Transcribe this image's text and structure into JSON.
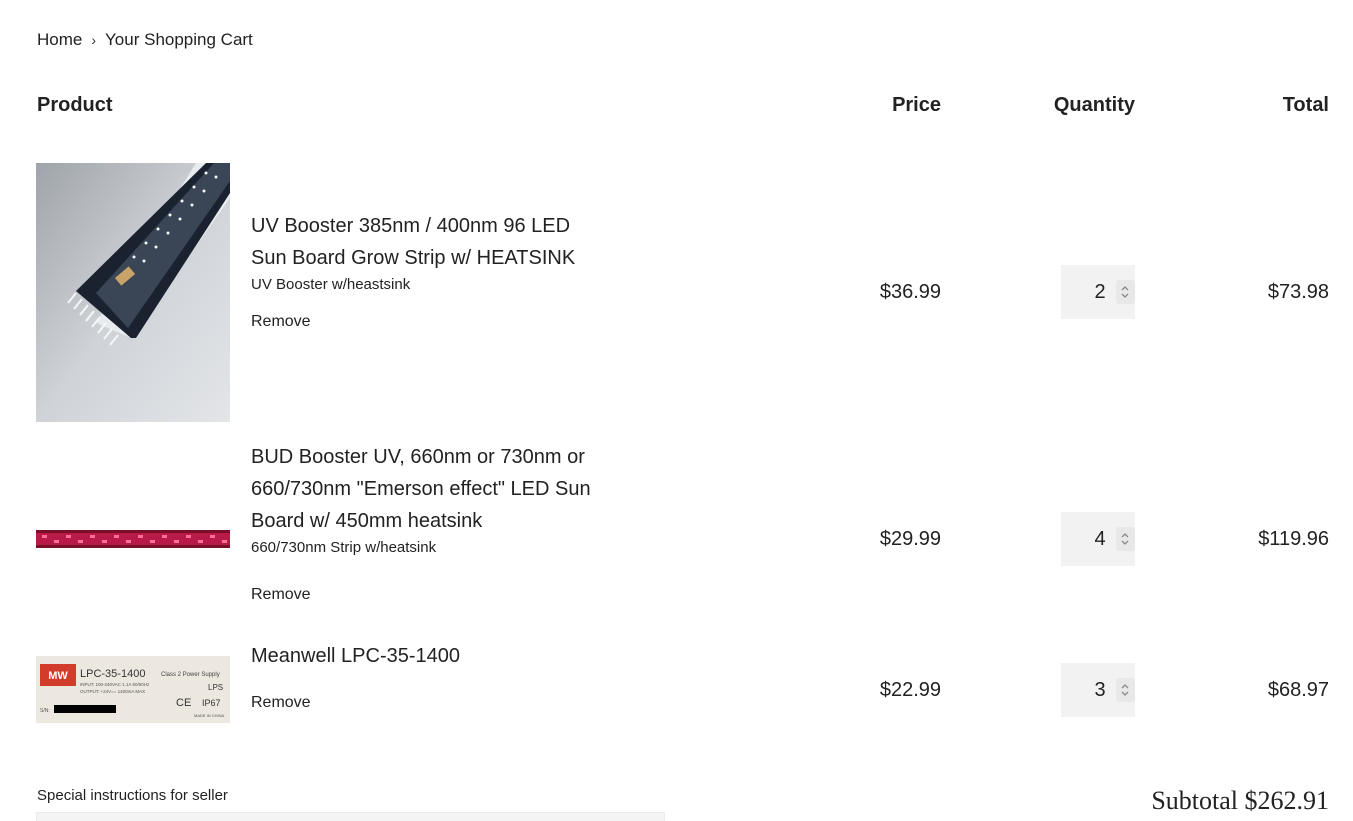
{
  "breadcrumb": {
    "home": "Home",
    "separator": "›",
    "current": "Your Shopping Cart"
  },
  "table_headers": {
    "product": "Product",
    "price": "Price",
    "quantity": "Quantity",
    "total": "Total"
  },
  "items": [
    {
      "title": "UV Booster 385nm / 400nm 96 LED Sun Board Grow Strip w/ HEATSINK",
      "variant": "UV Booster w/heastsink",
      "remove_label": "Remove",
      "price": "$36.99",
      "quantity": "2",
      "total": "$73.98",
      "image_icon": "led-strip-white-photo"
    },
    {
      "title": "BUD Booster UV, 660nm or 730nm or 660/730nm \"Emerson effect\" LED Sun Board w/ 450mm heatsink",
      "variant": "660/730nm Strip w/heatsink",
      "remove_label": "Remove",
      "price": "$29.99",
      "quantity": "4",
      "total": "$119.96",
      "image_icon": "led-strip-red-photo"
    },
    {
      "title": "Meanwell LPC-35-1400",
      "remove_label": "Remove",
      "price": "$22.99",
      "quantity": "3",
      "total": "$68.97",
      "image_icon": "power-supply-label-photo",
      "label_text": {
        "brand": "MW",
        "model": "LPC-35-1400",
        "class": "Class 2 Power Supply",
        "input": "INPUT: 100-240VAC 1.1A 50/60Hz",
        "output": "OUTPUT: +24V== 1400mA MAX",
        "lps": "LPS",
        "ce": "CE",
        "ip": "IP67",
        "sn": "S/N:",
        "made_in": "MADE IN CHINA"
      }
    }
  ],
  "special_instructions_label": "Special instructions for seller",
  "subtotal": {
    "label": "Subtotal",
    "value": "$262.91"
  }
}
